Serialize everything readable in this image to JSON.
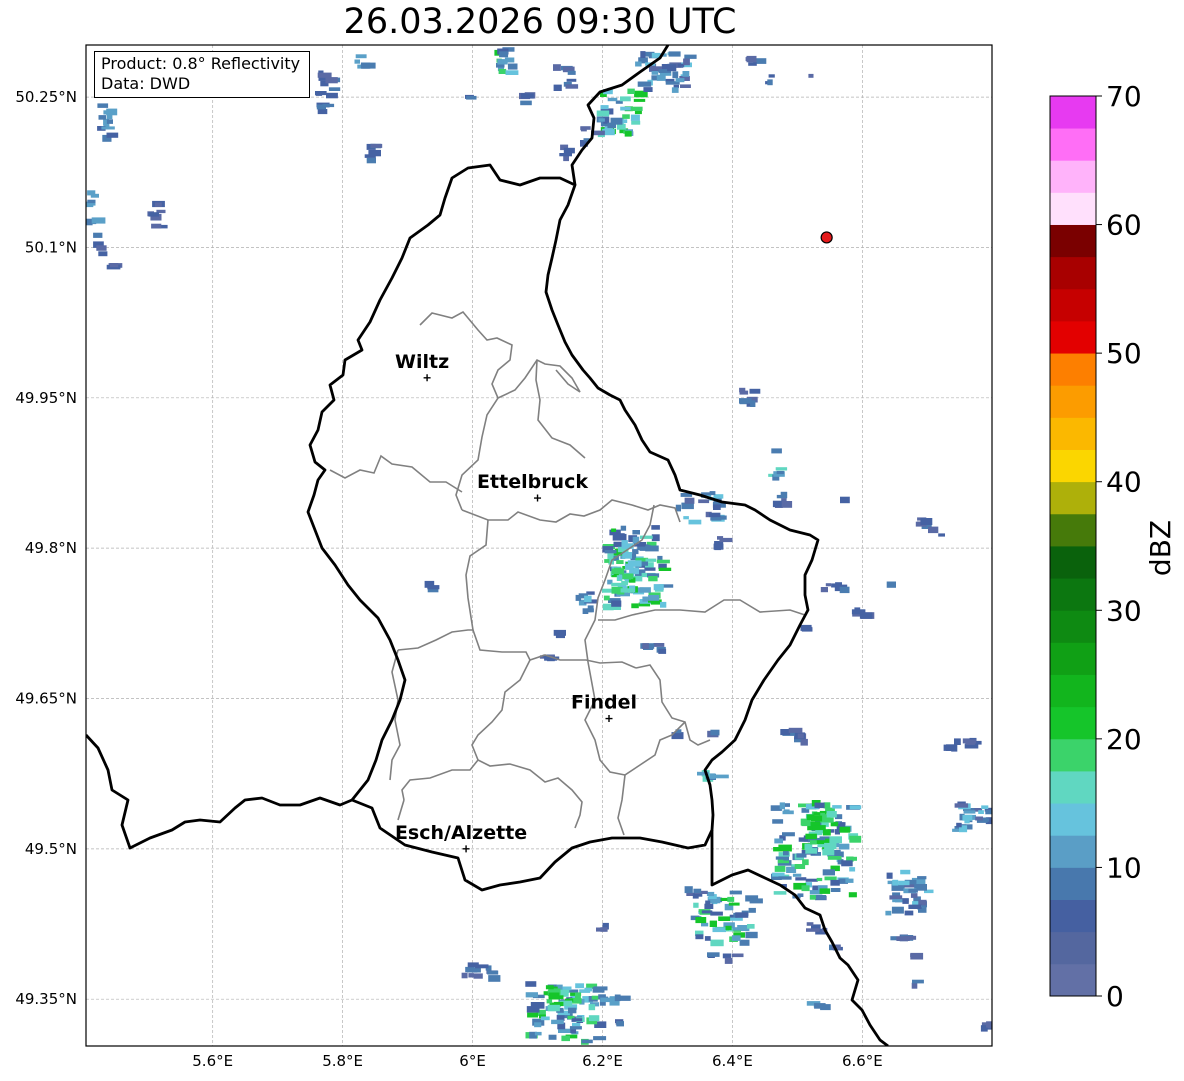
{
  "title": "26.03.2026 09:30 UTC",
  "info": {
    "product": "Product: 0.8° Reflectivity",
    "data_source": "Data: DWD"
  },
  "axes": {
    "lat_ticks": [
      "50.25°N",
      "50.1°N",
      "49.95°N",
      "49.8°N",
      "49.65°N",
      "49.5°N",
      "49.35°N"
    ],
    "lon_ticks": [
      "5.6°E",
      "5.8°E",
      "6°E",
      "6.2°E",
      "6.4°E",
      "6.6°E"
    ]
  },
  "cities": [
    {
      "name": "Wiltz",
      "lon": 5.93,
      "lat": 49.97
    },
    {
      "name": "Ettelbruck",
      "lon": 6.1,
      "lat": 49.85
    },
    {
      "name": "Findel",
      "lon": 6.21,
      "lat": 49.63
    },
    {
      "name": "Esch/Alzette",
      "lon": 5.99,
      "lat": 49.5
    }
  ],
  "marker": {
    "lon": 6.545,
    "lat": 50.11,
    "color": "#e41a1c"
  },
  "colorbar": {
    "label": "dBZ",
    "ticks": [
      "0",
      "10",
      "20",
      "30",
      "40",
      "50",
      "60",
      "70"
    ],
    "colors": [
      "#6270a6",
      "#54679f",
      "#4560a1",
      "#4878ad",
      "#5a9ec6",
      "#66c3dd",
      "#60d7c1",
      "#3bd36a",
      "#15c52a",
      "#12b51d",
      "#10a015",
      "#0e8a12",
      "#0c7710",
      "#0a620c",
      "#467a0a",
      "#aeb00a",
      "#fbd600",
      "#fbb800",
      "#fc9c00",
      "#fd7f00",
      "#e30000",
      "#c60000",
      "#a80000",
      "#7a0000",
      "#ffe0fc",
      "#ffb3fa",
      "#ff6ef6",
      "#e73af1"
    ]
  },
  "map_colors": {
    "country_border": "#000000",
    "canton_border": "#808080",
    "grid": "#b0b0b0"
  }
}
